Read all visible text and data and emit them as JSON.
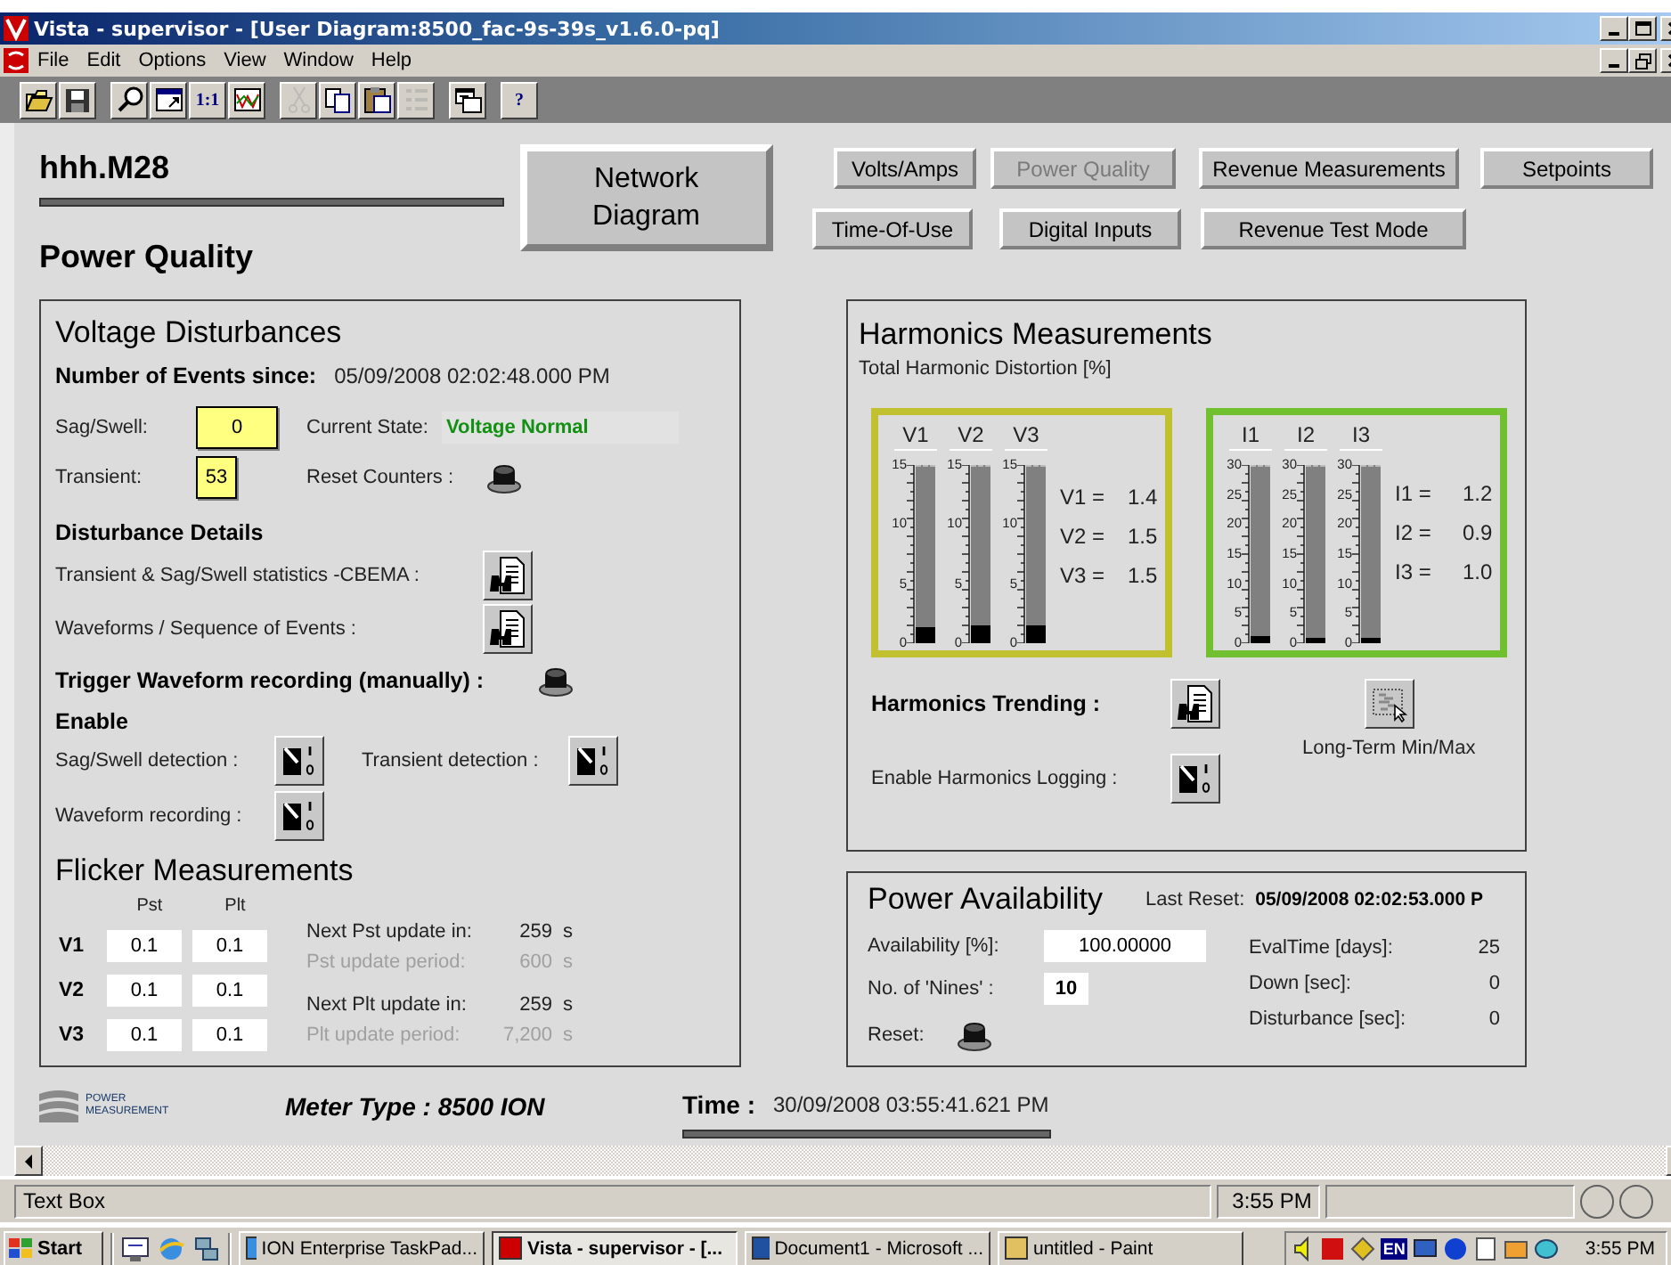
{
  "window": {
    "title": "Vista - supervisor - [User Diagram:8500_fac-9s-39s_v1.6.0-pq]"
  },
  "menu": [
    "File",
    "Edit",
    "Options",
    "View",
    "Window",
    "Help"
  ],
  "toolbar": [
    [
      {
        "kind": "open",
        "disabled": false
      },
      {
        "kind": "save",
        "disabled": false
      }
    ],
    [
      {
        "kind": "zoom",
        "disabled": false
      },
      {
        "kind": "fit",
        "disabled": false
      },
      {
        "kind": "text",
        "label": "1:1",
        "disabled": false
      },
      {
        "kind": "trend",
        "disabled": false
      }
    ],
    [
      {
        "kind": "cut",
        "disabled": true
      },
      {
        "kind": "copy",
        "disabled": false
      },
      {
        "kind": "paste",
        "disabled": false
      },
      {
        "kind": "list",
        "disabled": true
      }
    ],
    [
      {
        "kind": "cascade",
        "disabled": false
      }
    ],
    [
      {
        "kind": "text",
        "label": "?",
        "disabled": false
      }
    ]
  ],
  "header": {
    "device": "hhh.M28",
    "page": "Power Quality"
  },
  "network_button": "Network Diagram",
  "nav_rows": [
    [
      {
        "label": "Volts/Amps",
        "disabled": false
      },
      {
        "label": "Power Quality",
        "disabled": true
      },
      {
        "label": "Revenue Measurements",
        "disabled": false
      },
      {
        "label": "Setpoints",
        "disabled": false
      }
    ],
    [
      {
        "label": "Time-Of-Use",
        "disabled": false
      },
      {
        "label": "Digital Inputs",
        "disabled": false
      },
      {
        "label": "Revenue Test Mode",
        "disabled": false
      }
    ]
  ],
  "voltage_disturbances": {
    "title": "Voltage Disturbances",
    "events_label": "Number of Events since:",
    "events_since": "05/09/2008 02:02:48.000 PM",
    "counters": [
      {
        "label": "Sag/Swell:",
        "value": "0"
      },
      {
        "label": "Transient:",
        "value": "53"
      }
    ],
    "current_state_label": "Current State:",
    "current_state": "Voltage Normal",
    "reset_label": "Reset Counters :",
    "details_title": "Disturbance Details",
    "details": [
      "Transient & Sag/Swell statistics -CBEMA :",
      "Waveforms / Sequence of Events :"
    ],
    "trigger_label": "Trigger Waveform recording (manually) :",
    "enable_title": "Enable",
    "enables": [
      "Sag/Swell detection :",
      "Transient detection :",
      "Waveform recording :"
    ]
  },
  "flicker": {
    "title": "Flicker Measurements",
    "columns": [
      "Pst",
      "Plt"
    ],
    "rows": [
      {
        "name": "V1",
        "pst": "0.1",
        "plt": "0.1"
      },
      {
        "name": "V2",
        "pst": "0.1",
        "plt": "0.1"
      },
      {
        "name": "V3",
        "pst": "0.1",
        "plt": "0.1"
      }
    ],
    "updates": [
      {
        "label": "Next Pst update in:",
        "value": "259",
        "unit": "s",
        "dimmed": false
      },
      {
        "label": "Pst update period:",
        "value": "600",
        "unit": "s",
        "dimmed": true
      },
      {
        "label": "Next Plt update in:",
        "value": "259",
        "unit": "s",
        "dimmed": false
      },
      {
        "label": "Plt update period:",
        "value": "7,200",
        "unit": "s",
        "dimmed": true
      }
    ]
  },
  "harmonics": {
    "title": "Harmonics Measurements",
    "subtitle": "Total Harmonic Distortion [%]",
    "groups": [
      {
        "color": "#c0c030",
        "gauges": [
          {
            "name": "V1",
            "level": 0.093,
            "scale": [
              "15",
              "10",
              "5",
              "0"
            ]
          },
          {
            "name": "V2",
            "level": 0.1,
            "scale": [
              "15",
              "10",
              "5",
              "0"
            ]
          },
          {
            "name": "V3",
            "level": 0.1,
            "scale": [
              "15",
              "10",
              "5",
              "0"
            ]
          }
        ],
        "readings": [
          {
            "label": "V1 =",
            "value": "1.4"
          },
          {
            "label": "V2 =",
            "value": "1.5"
          },
          {
            "label": "V3 =",
            "value": "1.5"
          }
        ]
      },
      {
        "color": "#70c030",
        "gauges": [
          {
            "name": "I1",
            "level": 0.04,
            "scale": [
              "30",
              "25",
              "20",
              "15",
              "10",
              "5",
              "0"
            ]
          },
          {
            "name": "I2",
            "level": 0.03,
            "scale": [
              "30",
              "25",
              "20",
              "15",
              "10",
              "5",
              "0"
            ]
          },
          {
            "name": "I3",
            "level": 0.033,
            "scale": [
              "30",
              "25",
              "20",
              "15",
              "10",
              "5",
              "0"
            ]
          }
        ],
        "readings": [
          {
            "label": "I1 =",
            "value": "1.2"
          },
          {
            "label": "I2 =",
            "value": "0.9"
          },
          {
            "label": "I3 =",
            "value": "1.0"
          }
        ]
      }
    ],
    "trending_label": "Harmonics Trending :",
    "minmax_label": "Long-Term Min/Max",
    "logging_label": "Enable Harmonics Logging :"
  },
  "availability": {
    "title": "Power Availability",
    "last_reset_label": "Last Reset:",
    "last_reset": "05/09/2008 02:02:53.000 P",
    "fields": [
      {
        "label": "Availability [%]:",
        "value": "100.00000"
      },
      {
        "label": "No. of 'Nines' :",
        "value": "10"
      }
    ],
    "reset_label": "Reset:",
    "stats": [
      {
        "label": "EvalTime [days]:",
        "value": "25"
      },
      {
        "label": "Down [sec]:",
        "value": "0"
      },
      {
        "label": "Disturbance [sec]:",
        "value": "0"
      }
    ]
  },
  "footer": {
    "logo_lines": [
      "POWER",
      "MEASUREMENT"
    ],
    "meter_type": "Meter Type : 8500 ION",
    "time_label": "Time :",
    "time": "30/09/2008 03:55:41.621 PM"
  },
  "status_bar": {
    "text": "Text Box",
    "time": "3:55 PM"
  },
  "taskbar": {
    "start": "Start",
    "tasks": [
      {
        "label": "ION Enterprise TaskPad...",
        "selected": false
      },
      {
        "label": "Vista - supervisor - [...",
        "selected": true
      },
      {
        "label": "Document1 - Microsoft ...",
        "selected": false
      },
      {
        "label": "untitled - Paint",
        "selected": false
      }
    ],
    "tray_lang": "EN",
    "clock": "3:55 PM"
  }
}
